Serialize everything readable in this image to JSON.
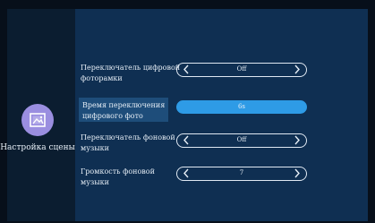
{
  "sidebar": {
    "label": "Настройка сцены",
    "icon": "image-icon"
  },
  "settings": [
    {
      "label": "Переключатель цифровой фоторамки",
      "value": "Off",
      "style": "arrows"
    },
    {
      "label": "Время переключения цифрового фото",
      "value": "6s",
      "style": "highlight"
    },
    {
      "label": "Переключатель фоновой музыки",
      "value": "Off",
      "style": "arrows"
    },
    {
      "label": "Громкость фоновой музыки",
      "value": "7",
      "style": "arrows"
    }
  ],
  "colors": {
    "background": "#070f1a",
    "panel": "#0f2f52",
    "selected_label": "#1e4d7a",
    "highlight": "#2e9be6",
    "icon_circle": "#9a8ee0"
  }
}
